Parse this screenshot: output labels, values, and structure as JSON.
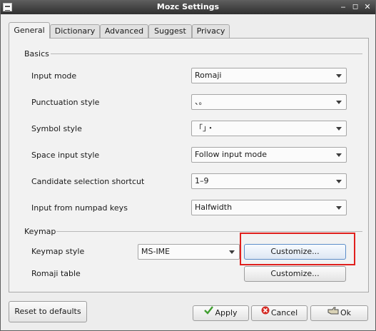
{
  "window": {
    "title": "Mozc Settings"
  },
  "tabs": [
    {
      "label": "General",
      "active": true
    },
    {
      "label": "Dictionary"
    },
    {
      "label": "Advanced"
    },
    {
      "label": "Suggest"
    },
    {
      "label": "Privacy"
    }
  ],
  "basics": {
    "title": "Basics",
    "rows": [
      {
        "label": "Input mode",
        "value": "Romaji"
      },
      {
        "label": "Punctuation style",
        "value": "、。"
      },
      {
        "label": "Symbol style",
        "value": "「」・"
      },
      {
        "label": "Space input style",
        "value": "Follow input mode"
      },
      {
        "label": "Candidate selection shortcut",
        "value": "1–9"
      },
      {
        "label": "Input from numpad keys",
        "value": "Halfwidth"
      }
    ]
  },
  "keymap": {
    "title": "Keymap",
    "style_label": "Keymap style",
    "style_value": "MS-IME",
    "customize_label": "Customize...",
    "romaji_label": "Romaji table",
    "romaji_customize_label": "Customize..."
  },
  "buttons": {
    "reset": "Reset to defaults",
    "apply": "Apply",
    "cancel": "Cancel",
    "ok": "Ok"
  },
  "colors": {
    "highlight": "#e0201d",
    "apply_icon": "#3f9e2f",
    "cancel_icon": "#d42b24"
  }
}
